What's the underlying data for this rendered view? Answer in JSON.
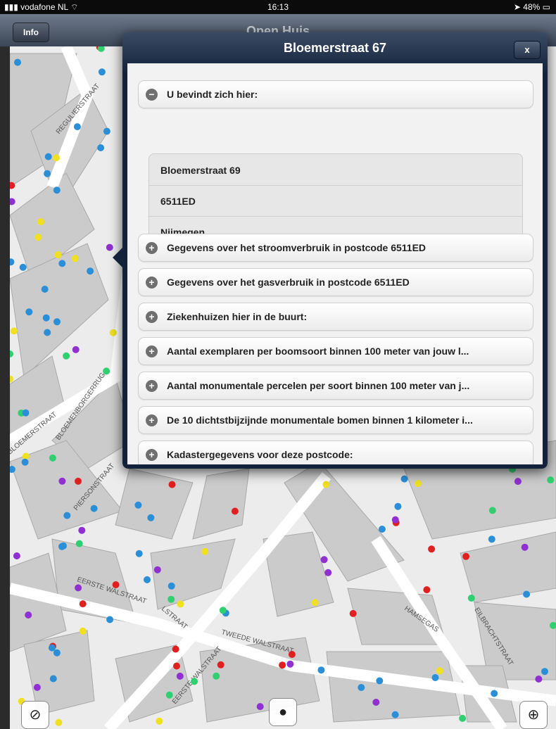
{
  "status": {
    "carrier": "vodafone NL",
    "time": "16:13",
    "battery": "48%"
  },
  "navbar": {
    "title": "Open Huis",
    "info_label": "Info"
  },
  "popover": {
    "title": "Bloemerstraat 67",
    "close_label": "x",
    "here_section": "U bevindt zich hier:",
    "address": [
      "Bloemerstraat 69",
      "6511ED",
      "Nijmegen"
    ],
    "sections": [
      "Gegevens over het stroomverbruik in postcode 6511ED",
      "Gegevens over het gasverbruik in postcode 6511ED",
      "Ziekenhuizen hier in de buurt:",
      "Aantal exemplaren per boomsoort binnen 100 meter van jouw l...",
      "Aantal monumentale percelen per soort binnen 100 meter van j...",
      "De 10 dichtstbijzijnde monumentale bomen binnen 1 kilometer i...",
      "Kadastergegevens voor deze postcode:"
    ]
  },
  "map": {
    "streets": [
      "REGULIERSTRAAT",
      "BLOEMERSTRAAT",
      "BLOEMENBORGERRUG",
      "PIERSONSTRAAT",
      "EERSTE WALSTRAAT",
      "TWEEDE WALSTRAAT",
      "EERSTE WALSTRAAT",
      "EILBRACHTSTRAAT",
      "HAMSEGAS",
      "LSTRAAT"
    ]
  },
  "colors": {
    "map_bg": "#ededed",
    "block": "#c9c9c9",
    "road": "#ffffff",
    "popover": "#13213a"
  },
  "icons": {
    "compass": "compass-icon",
    "bulb": "lightbulb-icon",
    "locate": "locate-icon",
    "wifi": "wifi-icon",
    "battery": "battery-icon"
  }
}
